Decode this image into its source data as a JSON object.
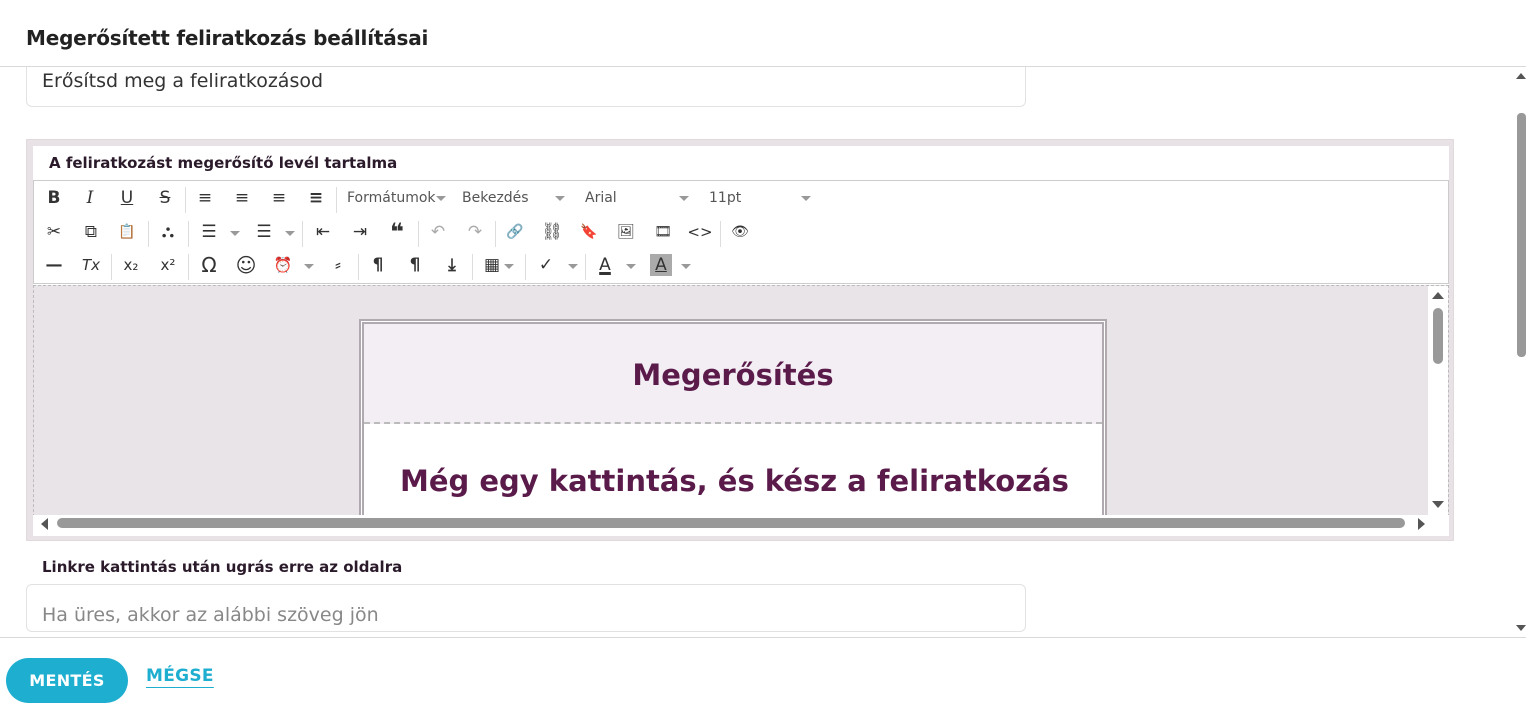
{
  "header": {
    "title": "Megerősített feliratkozás beállításai"
  },
  "subject_field": {
    "value": "Erősítsd meg a feliratkozásod"
  },
  "editor": {
    "label": "A feliratkozást megerősítő levél tartalma",
    "toolbar": {
      "row1": {
        "buttons": [
          {
            "name": "bold-icon",
            "glyph": "B"
          },
          {
            "name": "italic-icon",
            "glyph": "I"
          },
          {
            "name": "underline-icon",
            "glyph": "U"
          },
          {
            "name": "strikethrough-icon",
            "glyph": "S"
          },
          {
            "name": "align-left-icon",
            "glyph": "≡"
          },
          {
            "name": "align-center-icon",
            "glyph": "≡"
          },
          {
            "name": "align-right-icon",
            "glyph": "≡"
          },
          {
            "name": "align-justify-icon",
            "glyph": "≡"
          }
        ],
        "formats_label": "Formátumok",
        "paragraph_label": "Bekezdés",
        "font_family_label": "Arial",
        "font_size_label": "11pt"
      },
      "row2": [
        {
          "name": "cut-icon",
          "glyph": "✂"
        },
        {
          "name": "copy-icon",
          "glyph": "⧉"
        },
        {
          "name": "paste-icon",
          "glyph": "📋"
        },
        {
          "name": "find-icon",
          "glyph": "⛬"
        },
        {
          "name": "bullet-list-icon",
          "glyph": "☰"
        },
        {
          "name": "numbered-list-icon",
          "glyph": "☰"
        },
        {
          "name": "outdent-icon",
          "glyph": "⇤"
        },
        {
          "name": "indent-icon",
          "glyph": "⇥"
        },
        {
          "name": "blockquote-icon",
          "glyph": "❝"
        },
        {
          "name": "undo-icon",
          "glyph": "↶"
        },
        {
          "name": "redo-icon",
          "glyph": "↷"
        },
        {
          "name": "link-icon",
          "glyph": "🔗"
        },
        {
          "name": "unlink-icon",
          "glyph": "⛓"
        },
        {
          "name": "bookmark-icon",
          "glyph": "🔖"
        },
        {
          "name": "image-icon",
          "glyph": "🖼"
        },
        {
          "name": "media-icon",
          "glyph": "🎞"
        },
        {
          "name": "code-icon",
          "glyph": "<>"
        },
        {
          "name": "preview-icon",
          "glyph": "👁"
        }
      ],
      "row3": [
        {
          "name": "horizontal-rule-icon",
          "glyph": "—"
        },
        {
          "name": "clear-format-icon",
          "glyph": "Tx"
        },
        {
          "name": "subscript-icon",
          "glyph": "x₂"
        },
        {
          "name": "superscript-icon",
          "glyph": "x²"
        },
        {
          "name": "special-char-icon",
          "glyph": "Ω"
        },
        {
          "name": "emoticon-icon",
          "glyph": "☺"
        },
        {
          "name": "datetime-icon",
          "glyph": "⏰"
        },
        {
          "name": "page-break-icon",
          "glyph": "⸗"
        },
        {
          "name": "ltr-icon",
          "glyph": "¶"
        },
        {
          "name": "rtl-icon",
          "glyph": "¶"
        },
        {
          "name": "insert-icon",
          "glyph": "⤓"
        },
        {
          "name": "table-icon",
          "glyph": "▦"
        },
        {
          "name": "spellcheck-icon",
          "glyph": "✓"
        },
        {
          "name": "text-color-icon",
          "glyph": "A"
        },
        {
          "name": "background-color-icon",
          "glyph": "A"
        }
      ]
    },
    "content": {
      "heading": "Megerősítés",
      "body_title": "Még egy kattintás, és kész a feliratkozás"
    }
  },
  "redirect": {
    "label": "Linkre kattintás után ugrás erre az oldalra",
    "placeholder": "Ha üres, akkor az alábbi szöveg jön"
  },
  "footer": {
    "save_label": "MENTÉS",
    "cancel_label": "MÉGSE"
  },
  "colors": {
    "accent": "#1eaed0",
    "email_heading": "#5a1a4a"
  }
}
